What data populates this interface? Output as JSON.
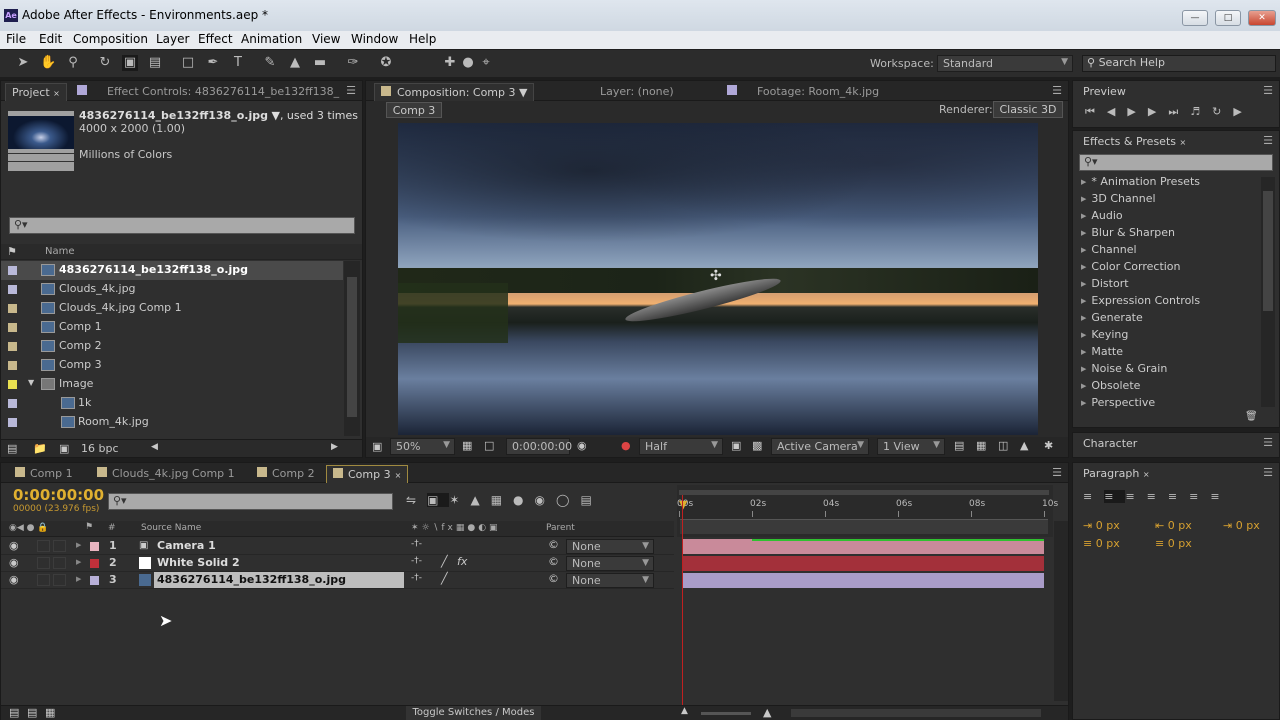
{
  "window": {
    "title": "Adobe After Effects - Environments.aep *",
    "logo": "Ae"
  },
  "menu": [
    "File",
    "Edit",
    "Composition",
    "Layer",
    "Effect",
    "Animation",
    "View",
    "Window",
    "Help"
  ],
  "toolbar": {
    "workspace_label": "Workspace:",
    "workspace_value": "Standard",
    "search_placeholder": "Search Help"
  },
  "project": {
    "tab": "Project",
    "effect_controls_tab": "Effect Controls: 4836276114_be132ff138_",
    "selected_name": "4836276114_be132ff138_o.jpg",
    "used": ", used 3 times",
    "dims": "4000 x 2000 (1.00)",
    "colors": "Millions of Colors",
    "column_name": "Name",
    "bpc": "16 bpc",
    "items": [
      {
        "name": "4836276114_be132ff138_o.jpg",
        "color": "#b9b9d9",
        "icon": "image-icon",
        "indent": 0,
        "selected": true
      },
      {
        "name": "Clouds_4k.jpg",
        "color": "#b9b9d9",
        "icon": "image-icon",
        "indent": 0
      },
      {
        "name": "Clouds_4k.jpg Comp 1",
        "color": "#c8b88c",
        "icon": "comp-icon",
        "indent": 0
      },
      {
        "name": "Comp 1",
        "color": "#c8b88c",
        "icon": "comp-icon",
        "indent": 0
      },
      {
        "name": "Comp 2",
        "color": "#c8b88c",
        "icon": "comp-icon",
        "indent": 0
      },
      {
        "name": "Comp 3",
        "color": "#c8b88c",
        "icon": "comp-icon",
        "indent": 0
      },
      {
        "name": "Image",
        "color": "#e8e050",
        "icon": "folder-icon",
        "indent": 0,
        "folder": true
      },
      {
        "name": "1k",
        "color": "#b9b9d9",
        "icon": "image-icon",
        "indent": 1
      },
      {
        "name": "Room_4k.jpg",
        "color": "#b9b9d9",
        "icon": "image-icon",
        "indent": 1
      }
    ]
  },
  "composition": {
    "tab": "Composition: Comp 3",
    "layer_tab": "Layer: (none)",
    "footage_tab": "Footage: Room_4k.jpg",
    "comp_button": "Comp 3",
    "renderer_label": "Renderer:",
    "renderer_value": "Classic 3D",
    "zoom": "50%",
    "timecode": "0:00:00:00",
    "resolution": "Half",
    "camera": "Active Camera",
    "views": "1 View"
  },
  "preview": {
    "tab": "Preview"
  },
  "effects": {
    "tab": "Effects & Presets",
    "items": [
      "* Animation Presets",
      "3D Channel",
      "Audio",
      "Blur & Sharpen",
      "Channel",
      "Color Correction",
      "Distort",
      "Expression Controls",
      "Generate",
      "Keying",
      "Matte",
      "Noise & Grain",
      "Obsolete",
      "Perspective"
    ]
  },
  "character": {
    "tab": "Character"
  },
  "paragraph": {
    "tab": "Paragraph",
    "fields": [
      "0 px",
      "0 px",
      "0 px",
      "0 px",
      "0 px"
    ]
  },
  "timeline": {
    "tabs": [
      "Comp 1",
      "Clouds_4k.jpg Comp 1",
      "Comp 2",
      "Comp 3"
    ],
    "timecode": "0:00:00:00",
    "fps": "00000 (23.976 fps)",
    "col_num": "#",
    "col_source": "Source Name",
    "col_parent": "Parent",
    "toggle": "Toggle Switches / Modes",
    "ruler": [
      "00s",
      "02s",
      "04s",
      "06s",
      "08s",
      "10s"
    ],
    "layers": [
      {
        "num": "1",
        "name": "Camera 1",
        "color": "#e8b4c0",
        "icon": "camera-icon",
        "parent": "None",
        "bar": "#c98a9a"
      },
      {
        "num": "2",
        "name": "White Solid 2",
        "color": "#c0303a",
        "icon": "solid-icon",
        "parent": "None",
        "bar": "#a3303a"
      },
      {
        "num": "3",
        "name": "4836276114_be132ff138_o.jpg",
        "color": "#b8b0d8",
        "icon": "image-icon",
        "parent": "None",
        "bar": "#a99cc8"
      }
    ]
  }
}
